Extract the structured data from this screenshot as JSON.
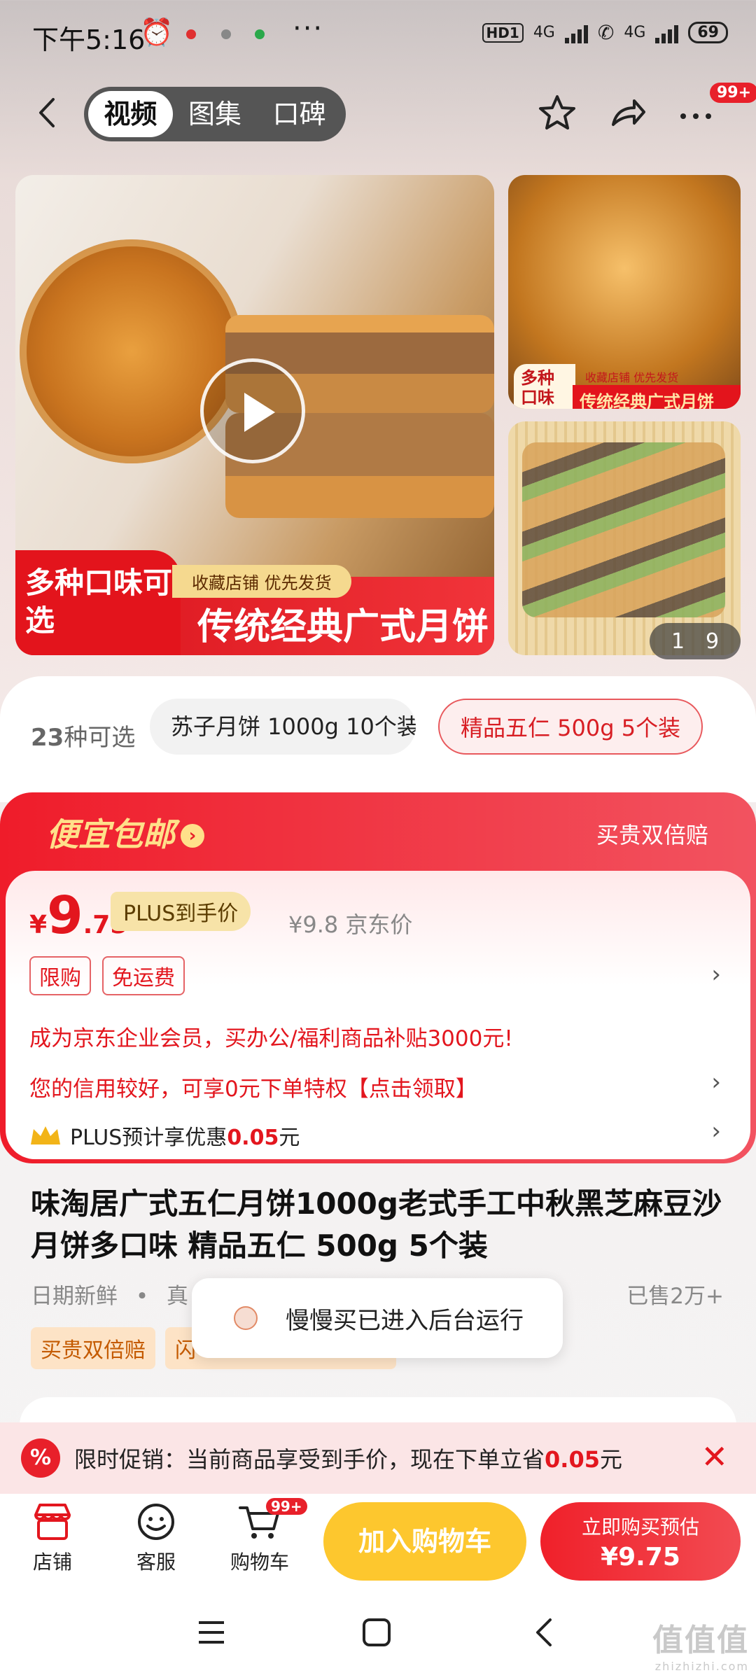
{
  "status_bar": {
    "time": "下午5:16",
    "network_hd": "HD1",
    "network_label_1": "4G",
    "network_label_2": "4G",
    "battery": "69"
  },
  "top_nav": {
    "tabs": [
      {
        "label": "视频",
        "active": true
      },
      {
        "label": "图集",
        "active": false
      },
      {
        "label": "口碑",
        "active": false
      }
    ],
    "more_badge": "99+"
  },
  "gallery": {
    "main_banner_tag": "多种口味可选",
    "main_banner_small": "收藏店铺  优先发货",
    "main_banner_big": "传统经典广式月饼",
    "side_tag": "多种口味",
    "side_banner": "传统经典广式月饼",
    "side_small": "收藏店铺 优先发货",
    "counter_current": "1",
    "counter_total": "9"
  },
  "variants": {
    "count_num": "23",
    "count_label": "种可选",
    "chips": [
      {
        "label": "苏子月饼 1000g 10个装",
        "selected": false
      },
      {
        "label": "精品五仁 500g 5个装",
        "selected": true
      }
    ]
  },
  "price_card": {
    "promo_title": "便宜包邮",
    "double_pay": "买贵双倍赔",
    "currency": "¥",
    "price_int": "9",
    "price_dec": ".75",
    "plus_tag": "PLUS到手价",
    "jd_price": "¥9.8 京东价",
    "tags": [
      "限购",
      "免运费"
    ],
    "enterprise_line": "成为京东企业会员，买办公/福利商品补贴3000元!",
    "credit_line": "您的信用较好，可享0元下单特权【点击领取】",
    "plus_prefix": "PLUS预计享优惠",
    "plus_amount": "0.05",
    "plus_suffix": "元"
  },
  "product": {
    "title": "味淘居广式五仁月饼1000g老式手工中秋黑芝麻豆沙月饼多口味 精品五仁 500g 5个装",
    "meta_1": "日期新鲜",
    "meta_2": "真",
    "sold": "已售2万+",
    "promo_tags": [
      "买贵双倍赔",
      "闪"
    ]
  },
  "toast": {
    "text": "慢慢买已进入后台运行"
  },
  "promo_bar": {
    "icon": "%",
    "text_prefix": "限时促销：当前商品享受到手价，现在下单立省",
    "amount": "0.05",
    "suffix": "元",
    "close": "✕"
  },
  "action_bar": {
    "shop_label": "店铺",
    "service_label": "客服",
    "cart_label": "购物车",
    "cart_badge": "99+",
    "add_cart": "加入购物车",
    "buy_line1": "立即购买预估",
    "buy_line2": "¥9.75"
  },
  "watermark": {
    "text": "值值值",
    "site": "zhizhizhi.com"
  },
  "colors": {
    "brand_red": "#e3161e",
    "cart_yellow": "#fdc72e",
    "plus_gold": "#f7e3a8"
  }
}
